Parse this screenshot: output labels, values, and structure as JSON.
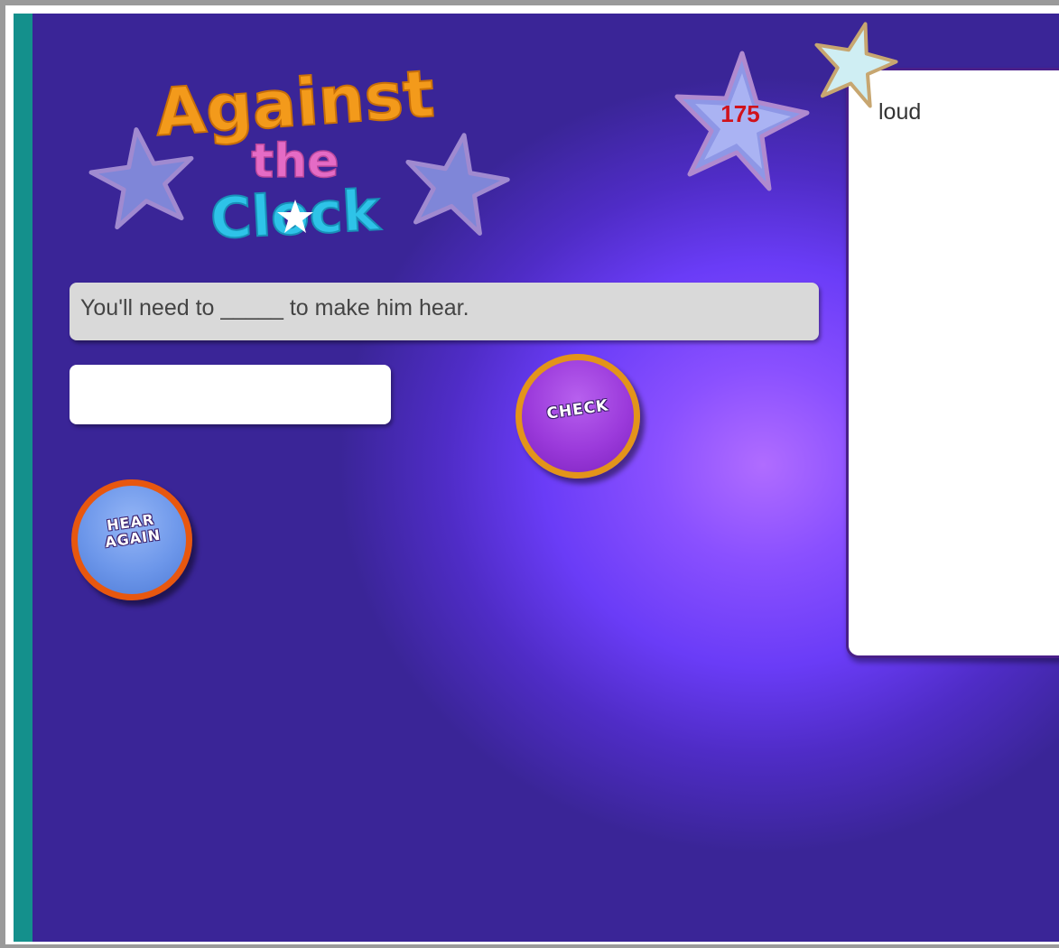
{
  "logo": {
    "line1": "Against",
    "line2": "the",
    "line3": "Clock"
  },
  "score": {
    "value": "175"
  },
  "word_panel": {
    "words": [
      "loud"
    ]
  },
  "question": {
    "sentence": "You'll need to _____ to make him hear."
  },
  "answer": {
    "value": "",
    "placeholder": ""
  },
  "buttons": {
    "check_label": "CHECK",
    "hear_line1": "HEAR",
    "hear_line2": "AGAIN"
  },
  "colors": {
    "stage_dark": "#37229a",
    "stage_glow": "#b06cff",
    "strip": "#14908c",
    "logo_orange": "#f39a1b",
    "logo_pink": "#e56bc5",
    "logo_cyan": "#2ec3e8",
    "score_red": "#d0121b",
    "check_purple": "#9b3adb",
    "check_ring": "#e3941a",
    "hear_blue": "#6d97ea",
    "hear_ring": "#e8570f"
  },
  "icons": [
    "logo-star-left-icon",
    "logo-star-right-icon",
    "clock-star-icon",
    "score-star-icon",
    "corner-star-icon"
  ]
}
